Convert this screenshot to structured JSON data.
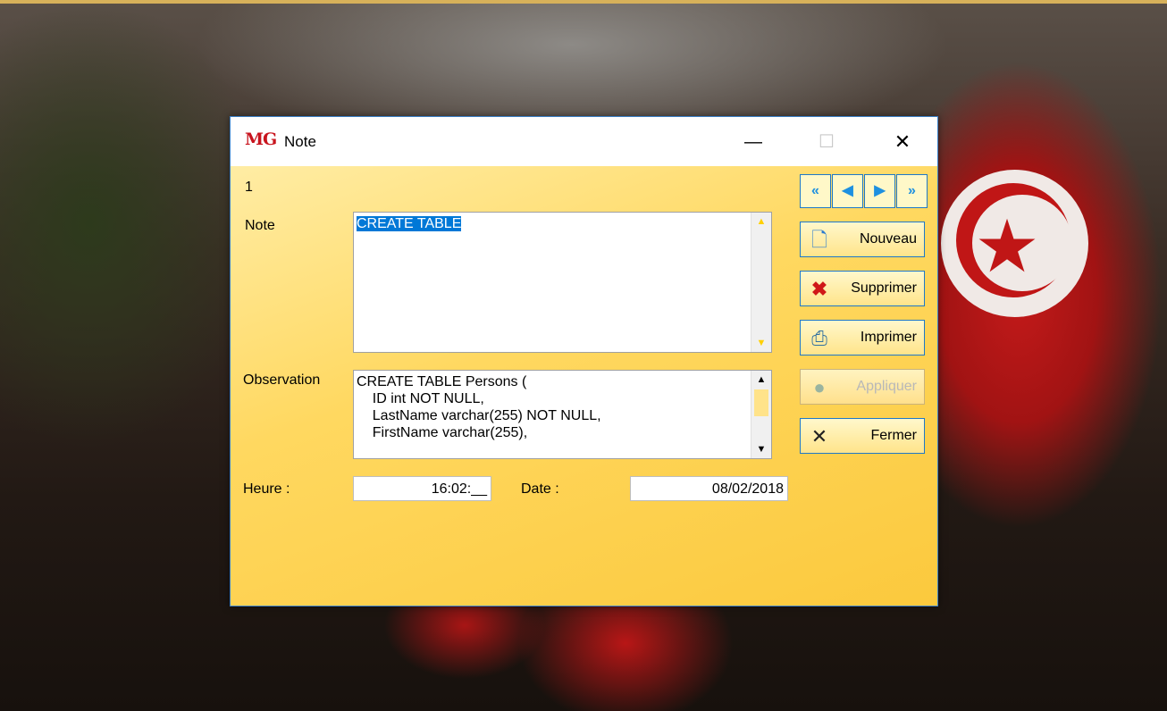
{
  "window": {
    "logo_text": "MG",
    "title": "Note",
    "minimize_glyph": "—",
    "maximize_glyph": "☐",
    "close_glyph": "✕"
  },
  "record": {
    "number": "1"
  },
  "form": {
    "note_label": "Note",
    "note_value_selected": "CREATE TABLE",
    "observation_label": "Observation",
    "observation_value": "CREATE TABLE Persons (\n    ID int NOT NULL,\n    LastName varchar(255) NOT NULL,\n    FirstName varchar(255),",
    "heure_label": "Heure :",
    "heure_value": "16:02:__",
    "date_label": "Date :",
    "date_value": "08/02/2018"
  },
  "nav": {
    "first_glyph": "«",
    "prev_glyph": "◀",
    "next_glyph": "▶",
    "last_glyph": "»"
  },
  "buttons": {
    "nouveau": "Nouveau",
    "supprimer": "Supprimer",
    "imprimer": "Imprimer",
    "appliquer": "Appliquer",
    "fermer": "Fermer"
  },
  "icons": {
    "nouveau": "new-document-icon",
    "supprimer": "delete-x-icon",
    "imprimer": "printer-icon",
    "appliquer": "apply-check-icon",
    "fermer": "close-x-icon"
  },
  "colors": {
    "dialog_gradient_start": "#fff0b0",
    "dialog_gradient_end": "#fbc93d",
    "selection": "#0078d7",
    "nav_arrow": "#1e90e0",
    "logo": "#c8141e"
  }
}
